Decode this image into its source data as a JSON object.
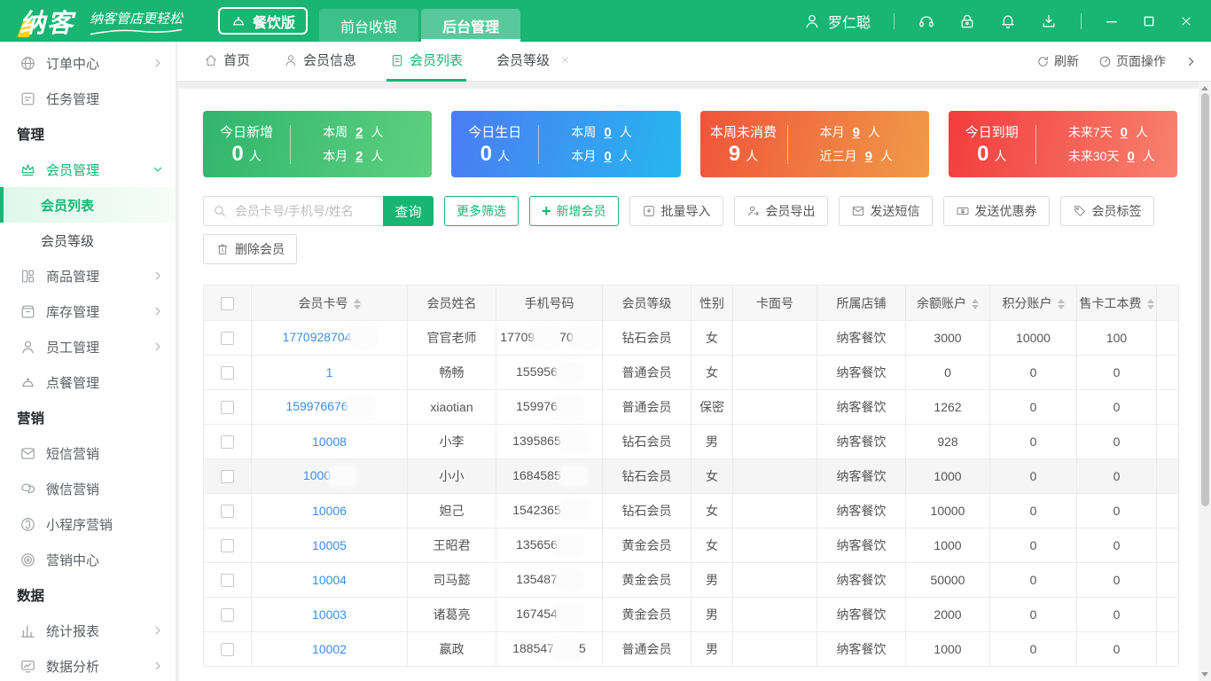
{
  "colors": {
    "topbar_green": "#18b573",
    "accent": "#18b573",
    "link_blue": "#3a8ee6",
    "card_gradients": {
      "green": [
        "#30b56d",
        "#5ed07f"
      ],
      "blue": [
        "#4b7cf3",
        "#26b6ef"
      ],
      "orange": [
        "#f0543a",
        "#f09b48"
      ],
      "red": [
        "#f23c3c",
        "#f8826f"
      ]
    }
  },
  "topbar": {
    "logo": "纳客",
    "slogan": "纳客管店更轻松",
    "badge": "餐饮版",
    "tabs": [
      {
        "key": "front-cashier",
        "label": "前台收银",
        "active": false
      },
      {
        "key": "backend-management",
        "label": "后台管理",
        "active": true
      }
    ],
    "user": "罗仁聪"
  },
  "sidebar": {
    "items": [
      {
        "type": "item",
        "key": "order-center",
        "icon": "globe",
        "label": "订单中心",
        "arrow": "right"
      },
      {
        "type": "item",
        "key": "task-management",
        "icon": "tasks",
        "label": "任务管理"
      },
      {
        "type": "header",
        "key": "management",
        "label": "管理"
      },
      {
        "type": "item",
        "key": "member-management",
        "icon": "crown",
        "label": "会员管理",
        "arrow": "down",
        "active": true
      },
      {
        "type": "sub",
        "key": "member-list",
        "label": "会员列表",
        "active": true
      },
      {
        "type": "sub",
        "key": "member-level",
        "label": "会员等级"
      },
      {
        "type": "item",
        "key": "goods-management",
        "icon": "goods",
        "label": "商品管理",
        "arrow": "right"
      },
      {
        "type": "item",
        "key": "inventory-management",
        "icon": "inventory",
        "label": "库存管理",
        "arrow": "right"
      },
      {
        "type": "item",
        "key": "staff-management",
        "icon": "staff",
        "label": "员工管理",
        "arrow": "right"
      },
      {
        "type": "item",
        "key": "ordering-management",
        "icon": "cloche",
        "label": "点餐管理"
      },
      {
        "type": "header",
        "key": "marketing",
        "label": "营销"
      },
      {
        "type": "item",
        "key": "sms-marketing",
        "icon": "mail",
        "label": "短信营销"
      },
      {
        "type": "item",
        "key": "wechat-marketing",
        "icon": "wechat",
        "label": "微信营销"
      },
      {
        "type": "item",
        "key": "miniprogram-marketing",
        "icon": "miniprogram",
        "label": "小程序营销"
      },
      {
        "type": "item",
        "key": "marketing-center",
        "icon": "target",
        "label": "营销中心"
      },
      {
        "type": "header",
        "key": "data",
        "label": "数据"
      },
      {
        "type": "item",
        "key": "statistics-report",
        "icon": "chart",
        "label": "统计报表",
        "arrow": "right"
      },
      {
        "type": "item",
        "key": "data-analysis",
        "icon": "monitor",
        "label": "数据分析",
        "arrow": "right"
      }
    ]
  },
  "page_tabs": {
    "tabs": [
      {
        "key": "home",
        "icon": "home",
        "label": "首页",
        "active": false
      },
      {
        "key": "member-info",
        "icon": "person",
        "label": "会员信息",
        "active": false
      },
      {
        "key": "member-list",
        "icon": "clipboard",
        "label": "会员列表",
        "active": true
      },
      {
        "key": "member-level",
        "label": "会员等级",
        "closable": true,
        "active": false
      }
    ],
    "refresh": "刷新",
    "page_ops": "页面操作"
  },
  "cards": [
    {
      "key": "new-today",
      "theme": "green",
      "title": "今日新增",
      "count": "0",
      "unit": "人",
      "stats": [
        {
          "label": "本周",
          "value": "2",
          "unit": "人"
        },
        {
          "label": "本月",
          "value": "2",
          "unit": "人"
        }
      ]
    },
    {
      "key": "birthday-today",
      "theme": "blue",
      "title": "今日生日",
      "count": "0",
      "unit": "人",
      "stats": [
        {
          "label": "本周",
          "value": "0",
          "unit": "人"
        },
        {
          "label": "本月",
          "value": "0",
          "unit": "人"
        }
      ]
    },
    {
      "key": "no-consume-week",
      "theme": "orange",
      "title": "本周未消费",
      "count": "9",
      "unit": "人",
      "stats": [
        {
          "label": "本月",
          "value": "9",
          "unit": "人"
        },
        {
          "label": "近三月",
          "value": "9",
          "unit": "人"
        }
      ]
    },
    {
      "key": "expire-today",
      "theme": "red",
      "title": "今日到期",
      "count": "0",
      "unit": "人",
      "stats": [
        {
          "label": "未来7天",
          "value": "0",
          "unit": "人"
        },
        {
          "label": "未来30天",
          "value": "0",
          "unit": "人"
        }
      ]
    }
  ],
  "toolbar": {
    "search_placeholder": "会员卡号/手机号/姓名",
    "search_button": "查询",
    "filter_button": "更多筛选",
    "add_button": "新增会员",
    "buttons": [
      {
        "key": "batch-import",
        "icon": "import",
        "label": "批量导入"
      },
      {
        "key": "member-export",
        "icon": "export",
        "label": "会员导出"
      },
      {
        "key": "send-sms",
        "icon": "mail",
        "label": "发送短信"
      },
      {
        "key": "send-coupon",
        "icon": "coupon",
        "label": "发送优惠券"
      },
      {
        "key": "member-tag",
        "icon": "tag",
        "label": "会员标签"
      }
    ],
    "delete_button": {
      "key": "delete-member",
      "icon": "trash",
      "label": "删除会员"
    }
  },
  "table": {
    "columns": [
      {
        "label": "会员卡号",
        "sortable": true
      },
      {
        "label": "会员姓名",
        "sortable": false
      },
      {
        "label": "手机号码",
        "sortable": false
      },
      {
        "label": "会员等级",
        "sortable": false
      },
      {
        "label": "性别",
        "sortable": false
      },
      {
        "label": "卡面号",
        "sortable": false
      },
      {
        "label": "所属店铺",
        "sortable": false
      },
      {
        "label": "余额账户",
        "sortable": true
      },
      {
        "label": "积分账户",
        "sortable": true
      },
      {
        "label": "售卡工本费",
        "sortable": true
      }
    ],
    "rows": [
      {
        "card_parts": [
          "1770928704",
          ""
        ],
        "name": "官官老师",
        "phone_parts": [
          "17709",
          "70",
          ""
        ],
        "level": "钻石会员",
        "gender": "女",
        "face": "",
        "store": "纳客餐饮",
        "balance": "3000",
        "points": "10000",
        "fee": "100",
        "highlighted": false
      },
      {
        "card_parts": [
          "1"
        ],
        "name": "畅畅",
        "phone_parts": [
          "155956",
          ""
        ],
        "level": "普通会员",
        "gender": "女",
        "face": "",
        "store": "纳客餐饮",
        "balance": "0",
        "points": "0",
        "fee": "0",
        "highlighted": false
      },
      {
        "card_parts": [
          "159976676",
          ""
        ],
        "name": "xiaotian",
        "phone_parts": [
          "159976",
          ""
        ],
        "level": "普通会员",
        "gender": "保密",
        "face": "",
        "store": "纳客餐饮",
        "balance": "1262",
        "points": "0",
        "fee": "0",
        "highlighted": false
      },
      {
        "card_parts": [
          "10008"
        ],
        "name": "小李",
        "phone_parts": [
          "1395865",
          ""
        ],
        "level": "钻石会员",
        "gender": "男",
        "face": "",
        "store": "纳客餐饮",
        "balance": "928",
        "points": "0",
        "fee": "0",
        "highlighted": false
      },
      {
        "card_parts": [
          "1000",
          ""
        ],
        "name": "小小",
        "phone_parts": [
          "1684585",
          ""
        ],
        "level": "钻石会员",
        "gender": "女",
        "face": "",
        "store": "纳客餐饮",
        "balance": "1000",
        "points": "0",
        "fee": "0",
        "highlighted": true
      },
      {
        "card_parts": [
          "10006"
        ],
        "name": "妲己",
        "phone_parts": [
          "1542365",
          ""
        ],
        "level": "钻石会员",
        "gender": "女",
        "face": "",
        "store": "纳客餐饮",
        "balance": "10000",
        "points": "0",
        "fee": "0",
        "highlighted": false
      },
      {
        "card_parts": [
          "10005"
        ],
        "name": "王昭君",
        "phone_parts": [
          "135656",
          ""
        ],
        "level": "黄金会员",
        "gender": "女",
        "face": "",
        "store": "纳客餐饮",
        "balance": "1000",
        "points": "0",
        "fee": "0",
        "highlighted": false
      },
      {
        "card_parts": [
          "10004"
        ],
        "name": "司马懿",
        "phone_parts": [
          "135487",
          ""
        ],
        "level": "黄金会员",
        "gender": "男",
        "face": "",
        "store": "纳客餐饮",
        "balance": "50000",
        "points": "0",
        "fee": "0",
        "highlighted": false
      },
      {
        "card_parts": [
          "10003"
        ],
        "name": "诸葛亮",
        "phone_parts": [
          "167454",
          ""
        ],
        "level": "黄金会员",
        "gender": "男",
        "face": "",
        "store": "纳客餐饮",
        "balance": "2000",
        "points": "0",
        "fee": "0",
        "highlighted": false
      },
      {
        "card_parts": [
          "10002"
        ],
        "name": "嬴政",
        "phone_parts": [
          "188547",
          "5"
        ],
        "level": "普通会员",
        "gender": "男",
        "face": "",
        "store": "纳客餐饮",
        "balance": "1000",
        "points": "0",
        "fee": "0",
        "highlighted": false
      }
    ]
  }
}
